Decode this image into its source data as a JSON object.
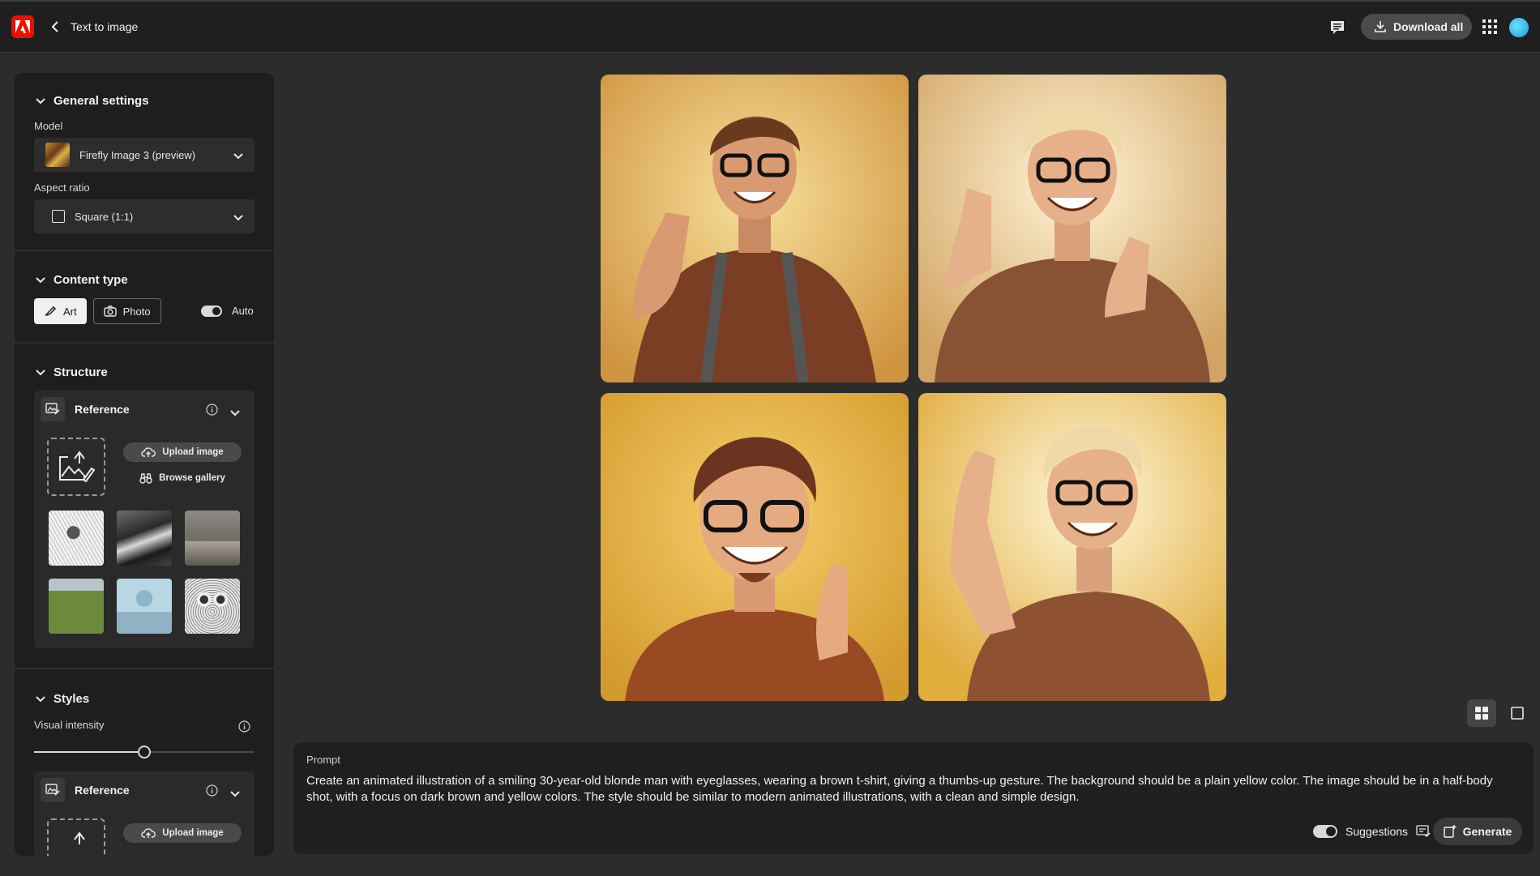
{
  "header": {
    "app_title": "Text to image",
    "download_all_label": "Download all"
  },
  "general_settings": {
    "title": "General settings",
    "model_label": "Model",
    "model_value": "Firefly Image 3 (preview)",
    "aspect_label": "Aspect ratio",
    "aspect_value": "Square (1:1)"
  },
  "content_type": {
    "title": "Content type",
    "art_label": "Art",
    "photo_label": "Photo",
    "auto_label": "Auto",
    "selected": "Art"
  },
  "structure": {
    "title": "Structure",
    "reference_label": "Reference",
    "upload_label": "Upload image",
    "browse_label": "Browse gallery",
    "thumbs": [
      "sketch-bird",
      "mountain-landscape",
      "living-room",
      "road-field",
      "sphere-pedestal",
      "owl-sketch"
    ]
  },
  "styles": {
    "title": "Styles",
    "visual_intensity_label": "Visual intensity",
    "visual_intensity_value": 0.5,
    "reference_label": "Reference",
    "upload_label": "Upload image"
  },
  "results": {
    "images": [
      {
        "description": "brown-haired man thumbs up"
      },
      {
        "description": "blonde man thumbs up"
      },
      {
        "description": "man with glasses and goatee"
      },
      {
        "description": "blonde man single thumb up"
      }
    ]
  },
  "prompt": {
    "label": "Prompt",
    "text": "Create an animated illustration of a smiling 30-year-old blonde man with eyeglasses, wearing a brown t-shirt, giving a thumbs-up gesture. The background should be a plain yellow color. The image should be in a half-body shot, with a focus on dark brown and yellow colors. The style should be similar to modern animated illustrations, with a clean and simple design.",
    "suggestions_label": "Suggestions",
    "generate_label": "Generate"
  },
  "colors": {
    "brand": "#eb1000",
    "panel": "#1e1e1e",
    "background": "#2c2c2c"
  }
}
